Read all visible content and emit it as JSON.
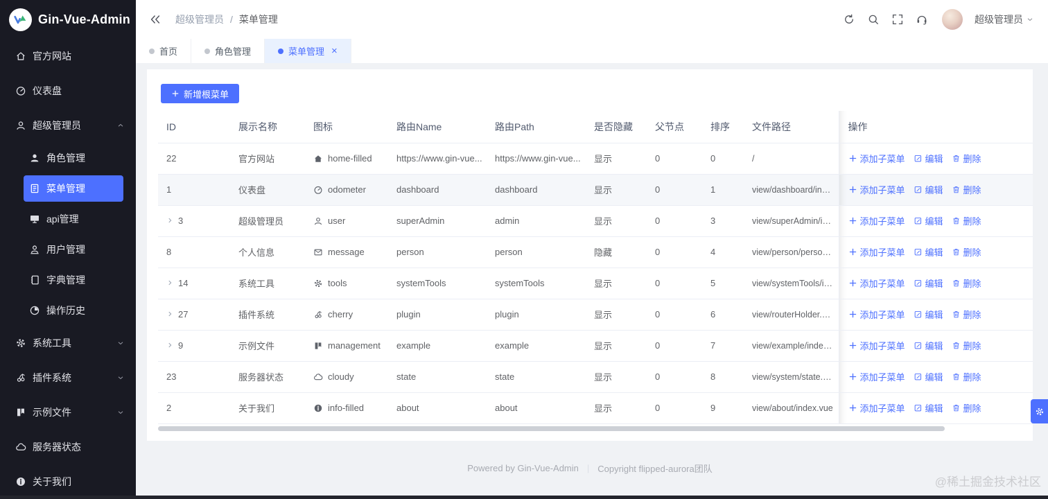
{
  "app": {
    "title": "Gin-Vue-Admin"
  },
  "topbar": {
    "breadcrumb": [
      "超级管理员",
      "菜单管理"
    ],
    "breadcrumb_separator": "/",
    "icons": [
      "refresh-icon",
      "search-icon",
      "fullscreen-icon",
      "headset-icon"
    ],
    "username": "超级管理员"
  },
  "tabs": [
    {
      "label": "首页",
      "active": false,
      "closable": false
    },
    {
      "label": "角色管理",
      "active": false,
      "closable": false
    },
    {
      "label": "菜单管理",
      "active": true,
      "closable": true
    }
  ],
  "sidebar": {
    "items": [
      {
        "label": "官方网站",
        "icon": "home"
      },
      {
        "label": "仪表盘",
        "icon": "odometer"
      },
      {
        "label": "超级管理员",
        "icon": "user",
        "expanded": true,
        "children": [
          {
            "label": "角色管理",
            "icon": "customer"
          },
          {
            "label": "菜单管理",
            "icon": "list",
            "active": true
          },
          {
            "label": "api管理",
            "icon": "monitor"
          },
          {
            "label": "用户管理",
            "icon": "avatar"
          },
          {
            "label": "字典管理",
            "icon": "notebook"
          },
          {
            "label": "操作历史",
            "icon": "history"
          }
        ]
      },
      {
        "label": "系统工具",
        "icon": "tools",
        "expandable": true
      },
      {
        "label": "插件系统",
        "icon": "cherry",
        "expandable": true
      },
      {
        "label": "示例文件",
        "icon": "management",
        "expandable": true
      },
      {
        "label": "服务器状态",
        "icon": "cloudy"
      },
      {
        "label": "关于我们",
        "icon": "info"
      }
    ]
  },
  "toolbar": {
    "add_root_menu": "新增根菜单"
  },
  "table": {
    "columns": [
      "ID",
      "展示名称",
      "图标",
      "路由Name",
      "路由Path",
      "是否隐藏",
      "父节点",
      "排序",
      "文件路径",
      "操作"
    ],
    "actions": {
      "add_child": "添加子菜单",
      "edit": "编辑",
      "delete": "删除"
    },
    "rows": [
      {
        "id": "22",
        "expandable": false,
        "name": "官方网站",
        "icon": "home-filled",
        "route_name": "https://www.gin-vue...",
        "route_path": "https://www.gin-vue...",
        "hidden": "显示",
        "parent": "0",
        "sort": "0",
        "file_path": "/",
        "highlight": false
      },
      {
        "id": "1",
        "expandable": false,
        "name": "仪表盘",
        "icon": "odometer",
        "route_name": "dashboard",
        "route_path": "dashboard",
        "hidden": "显示",
        "parent": "0",
        "sort": "1",
        "file_path": "view/dashboard/index.vu...",
        "highlight": true
      },
      {
        "id": "3",
        "expandable": true,
        "name": "超级管理员",
        "icon": "user",
        "route_name": "superAdmin",
        "route_path": "admin",
        "hidden": "显示",
        "parent": "0",
        "sort": "3",
        "file_path": "view/superAdmin/index.v...",
        "highlight": false
      },
      {
        "id": "8",
        "expandable": false,
        "name": "个人信息",
        "icon": "message",
        "route_name": "person",
        "route_path": "person",
        "hidden": "隐藏",
        "parent": "0",
        "sort": "4",
        "file_path": "view/person/person.vue",
        "highlight": false
      },
      {
        "id": "14",
        "expandable": true,
        "name": "系统工具",
        "icon": "tools",
        "route_name": "systemTools",
        "route_path": "systemTools",
        "hidden": "显示",
        "parent": "0",
        "sort": "5",
        "file_path": "view/systemTools/index.v...",
        "highlight": false
      },
      {
        "id": "27",
        "expandable": true,
        "name": "插件系统",
        "icon": "cherry",
        "route_name": "plugin",
        "route_path": "plugin",
        "hidden": "显示",
        "parent": "0",
        "sort": "6",
        "file_path": "view/routerHolder.vue",
        "highlight": false
      },
      {
        "id": "9",
        "expandable": true,
        "name": "示例文件",
        "icon": "management",
        "route_name": "example",
        "route_path": "example",
        "hidden": "显示",
        "parent": "0",
        "sort": "7",
        "file_path": "view/example/index.vue",
        "highlight": false
      },
      {
        "id": "23",
        "expandable": false,
        "name": "服务器状态",
        "icon": "cloudy",
        "route_name": "state",
        "route_path": "state",
        "hidden": "显示",
        "parent": "0",
        "sort": "8",
        "file_path": "view/system/state.vue",
        "highlight": false
      },
      {
        "id": "2",
        "expandable": false,
        "name": "关于我们",
        "icon": "info-filled",
        "route_name": "about",
        "route_path": "about",
        "hidden": "显示",
        "parent": "0",
        "sort": "9",
        "file_path": "view/about/index.vue",
        "highlight": false
      }
    ]
  },
  "footer": {
    "powered": "Powered by Gin-Vue-Admin",
    "separator": "|",
    "copyright": "Copyright flipped-aurora团队"
  },
  "watermark": "@稀土掘金技术社区",
  "colors": {
    "primary": "#4D70FF",
    "sidebar_bg": "#191A23",
    "page_bg": "#F0F2F5",
    "tab_active_bg": "#E9F1FE",
    "link": "#4D70FF"
  }
}
